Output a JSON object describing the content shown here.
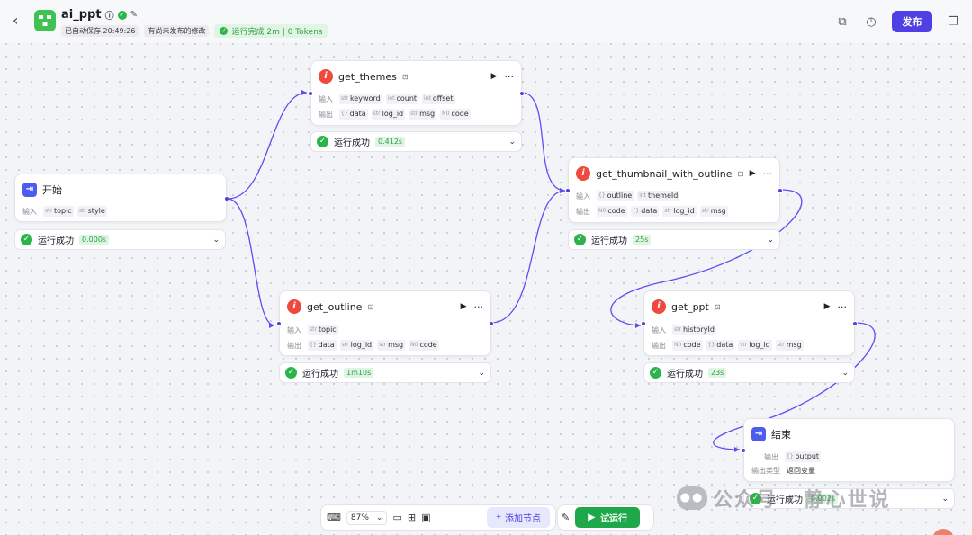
{
  "header": {
    "app_name": "ai_ppt",
    "autosave": "已自动保存 20:49:26",
    "unpublished": "有尚未发布的修改",
    "run_summary": "运行完成 2m | 0 Tokens",
    "publish_label": "发布"
  },
  "nodes": {
    "start": {
      "title": "开始",
      "input_label": "输入",
      "inputs": [
        {
          "type": "str",
          "name": "topic"
        },
        {
          "type": "str",
          "name": "style"
        }
      ],
      "status": "运行成功",
      "time": "0.000s"
    },
    "get_themes": {
      "title": "get_themes",
      "input_label": "输入",
      "output_label": "输出",
      "inputs": [
        {
          "type": "str",
          "name": "keyword"
        },
        {
          "type": "int",
          "name": "count"
        },
        {
          "type": "int",
          "name": "offset"
        }
      ],
      "outputs": [
        {
          "type": "{}",
          "name": "data"
        },
        {
          "type": "str",
          "name": "log_id"
        },
        {
          "type": "str",
          "name": "msg"
        },
        {
          "type": "N0",
          "name": "code"
        }
      ],
      "status": "运行成功",
      "time": "0.412s"
    },
    "get_outline": {
      "title": "get_outline",
      "input_label": "输入",
      "output_label": "输出",
      "inputs": [
        {
          "type": "str",
          "name": "topic"
        }
      ],
      "outputs": [
        {
          "type": "{}",
          "name": "data"
        },
        {
          "type": "str",
          "name": "log_id"
        },
        {
          "type": "str",
          "name": "msg"
        },
        {
          "type": "N0",
          "name": "code"
        }
      ],
      "status": "运行成功",
      "time": "1m10s"
    },
    "get_thumbnail": {
      "title": "get_thumbnail_with_outline",
      "input_label": "输入",
      "output_label": "输出",
      "inputs": [
        {
          "type": "{}",
          "name": "outline"
        },
        {
          "type": "int",
          "name": "themeId"
        }
      ],
      "outputs": [
        {
          "type": "N0",
          "name": "code"
        },
        {
          "type": "{}",
          "name": "data"
        },
        {
          "type": "str",
          "name": "log_id"
        },
        {
          "type": "str",
          "name": "msg"
        }
      ],
      "status": "运行成功",
      "time": "25s"
    },
    "get_ppt": {
      "title": "get_ppt",
      "input_label": "输入",
      "output_label": "输出",
      "inputs": [
        {
          "type": "str",
          "name": "historyId"
        }
      ],
      "outputs": [
        {
          "type": "N0",
          "name": "code"
        },
        {
          "type": "{}",
          "name": "data"
        },
        {
          "type": "str",
          "name": "log_id"
        },
        {
          "type": "str",
          "name": "msg"
        }
      ],
      "status": "运行成功",
      "time": "23s"
    },
    "end": {
      "title": "结束",
      "output_label": "输出",
      "outputs": [
        {
          "type": "{}",
          "name": "output"
        }
      ],
      "output_type_label": "输出类型",
      "output_type_value": "返回变量",
      "status": "运行成功",
      "time": "0.002s"
    }
  },
  "toolbar": {
    "zoom": "87%",
    "add_node": "添加节点",
    "run": "试运行"
  },
  "watermark": "公众号 · 静心世说",
  "colors": {
    "accent": "#4e40e5",
    "success": "#2bb44a",
    "plugin_icon": "#f0473f"
  }
}
